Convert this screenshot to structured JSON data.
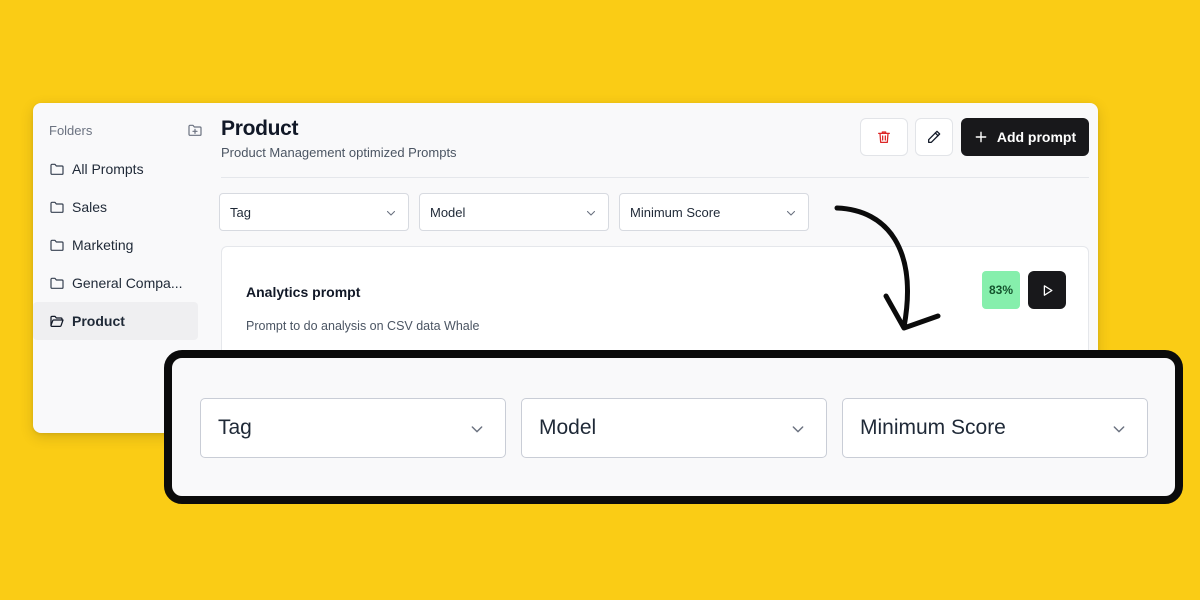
{
  "sidebar": {
    "heading": "Folders",
    "items": [
      {
        "label": "All Prompts"
      },
      {
        "label": "Sales"
      },
      {
        "label": "Marketing"
      },
      {
        "label": "General Compa..."
      },
      {
        "label": "Product"
      }
    ],
    "active_item": "Product"
  },
  "header": {
    "title": "Product",
    "subtitle": "Product Management optimized Prompts",
    "add_prompt_label": "Add prompt"
  },
  "filters": {
    "tag": "Tag",
    "model": "Model",
    "min_score": "Minimum Score"
  },
  "prompts": [
    {
      "title": "Analytics prompt",
      "description": "Prompt to do analysis on CSV data Whale",
      "score": "83%"
    }
  ],
  "zoom_callout": {
    "tag": "Tag",
    "model": "Model",
    "min_score": "Minimum Score"
  },
  "colors": {
    "background": "#FACC15",
    "primary_button": "#18181B",
    "score_badge": "#86EFAC",
    "delete_icon": "#DC2626"
  },
  "icons": [
    "folder-plus-icon",
    "folder-icon",
    "folder-open-icon",
    "trash-icon",
    "pencil-icon",
    "plus-icon",
    "chevron-down-icon",
    "play-icon",
    "curved-arrow-icon"
  ]
}
